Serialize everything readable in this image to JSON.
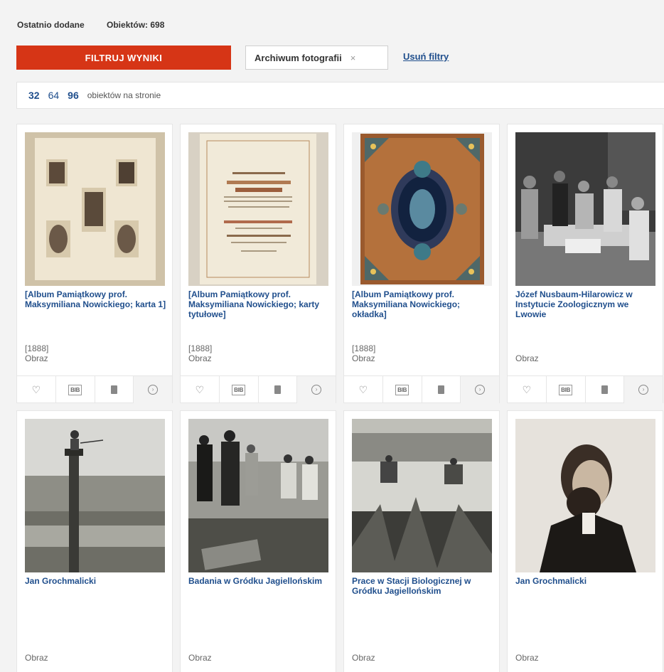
{
  "header": {
    "label": "Ostatnio dodane",
    "count": "Obiektów: 698"
  },
  "filter": {
    "button": "FILTRUJ WYNIKI",
    "chip": "Archiwum fotografii",
    "chip_close": "×",
    "clear": "Usuń filtry"
  },
  "perpage": {
    "options": [
      "32",
      "64",
      "96"
    ],
    "selected": "32",
    "suffix": "obiektów na stronie"
  },
  "icons": {
    "favorite": "heart-icon",
    "bib": "bib-icon",
    "save": "book-icon",
    "details": "chevron-right-circle-icon"
  },
  "bib_label": "BIB",
  "colors": {
    "accent": "#d63516",
    "link": "#1f4e8c"
  },
  "cards": [
    {
      "title": "[Album Pamiątkowy prof. Maksymiliana Nowickiego; karta 1]",
      "date": "[1888]",
      "type": "Obraz",
      "img": "album-page"
    },
    {
      "title": "[Album Pamiątkowy prof. Maksymiliana Nowickiego; karty tytułowe]",
      "date": "[1888]",
      "type": "Obraz",
      "img": "title-page"
    },
    {
      "title": "[Album Pamiątkowy prof. Maksymiliana Nowickiego; okładka]",
      "date": "[1888]",
      "type": "Obraz",
      "img": "cover"
    },
    {
      "title": "Józef Nusbaum-Hilarowicz w Instytucie Zoologicznym we Lwowie",
      "date": "",
      "type": "Obraz",
      "img": "lab-photo"
    },
    {
      "title": "Jan Grochmalicki",
      "date": "",
      "type": "Obraz",
      "img": "pole-photo"
    },
    {
      "title": "Badania w Gródku Jagiellońskim",
      "date": "",
      "type": "Obraz",
      "img": "group-photo"
    },
    {
      "title": "Prace w Stacji Biologicznej w Gródku Jagiellońskim",
      "date": "",
      "type": "Obraz",
      "img": "reeds-photo"
    },
    {
      "title": "Jan Grochmalicki",
      "date": "",
      "type": "Obraz",
      "img": "portrait-photo"
    }
  ]
}
